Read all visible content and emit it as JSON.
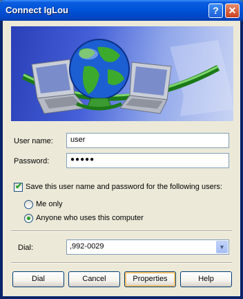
{
  "window": {
    "title": "Connect IgLou"
  },
  "titlebar": {
    "help_glyph": "?",
    "close_glyph": "✕"
  },
  "form": {
    "username_label": "User name:",
    "username_value": "user",
    "password_label": "Password:",
    "password_value": "●●●●●",
    "save_checkbox_label": "Save this user name and password for the following users:",
    "save_checked": true,
    "radio_me_only_label": "Me only",
    "radio_anyone_label": "Anyone who uses this computer",
    "selected_radio": "anyone",
    "dial_label": "Dial:",
    "dial_value": ",992-0029"
  },
  "buttons": {
    "dial": "Dial",
    "cancel": "Cancel",
    "properties": "Properties",
    "help": "Help"
  },
  "icons": {
    "banner": "network-globe-laptops-illustration",
    "dropdown": "chevron-down-icon",
    "check": "checkmark-icon"
  },
  "colors": {
    "titlebar": "#0052d6",
    "dialog_bg": "#ece9d8",
    "check_green": "#21a121"
  }
}
